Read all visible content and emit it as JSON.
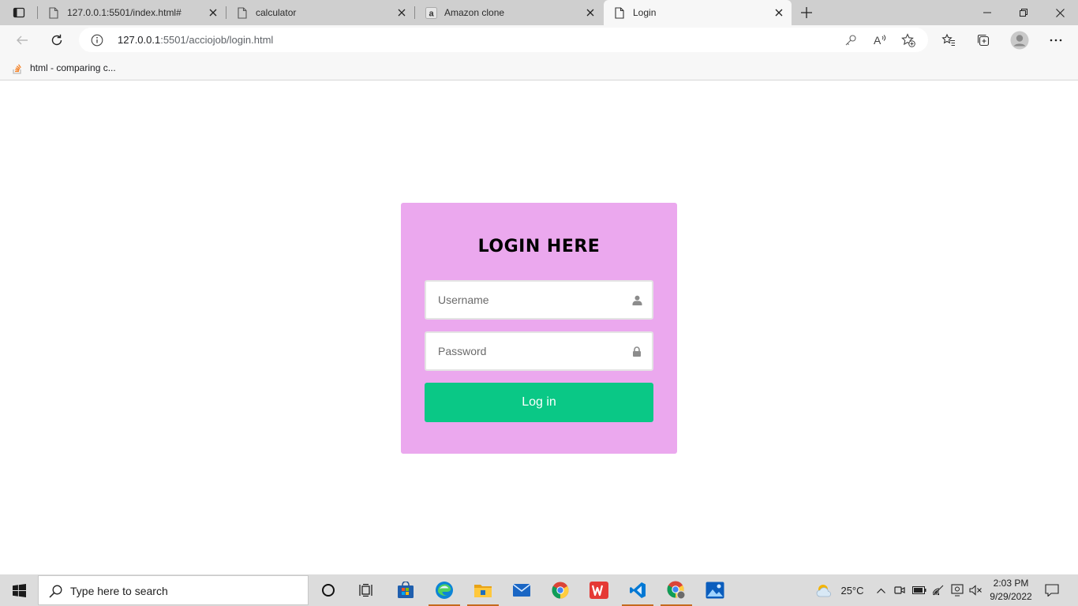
{
  "browser": {
    "tabs": [
      {
        "title": "127.0.0.1:5501/index.html#",
        "favicon": "page-icon",
        "active": false
      },
      {
        "title": "calculator",
        "favicon": "page-icon",
        "active": false
      },
      {
        "title": "Amazon clone",
        "favicon": "amazon-icon",
        "active": false
      },
      {
        "title": "Login",
        "favicon": "page-icon",
        "active": true
      }
    ],
    "address": {
      "host": "127.0.0.1",
      "path": ":5501/acciojob/login.html"
    },
    "favorites": [
      {
        "label": "html - comparing c...",
        "favicon": "stackoverflow-icon"
      }
    ]
  },
  "login": {
    "title": "LOGIN HERE",
    "username_placeholder": "Username",
    "password_placeholder": "Password",
    "button_label": "Log in",
    "colors": {
      "card": "#eba8ee",
      "button": "#0ac886"
    }
  },
  "taskbar": {
    "search_placeholder": "Type here to search",
    "weather": "25°C",
    "time": "2:03 PM",
    "date": "9/29/2022"
  }
}
